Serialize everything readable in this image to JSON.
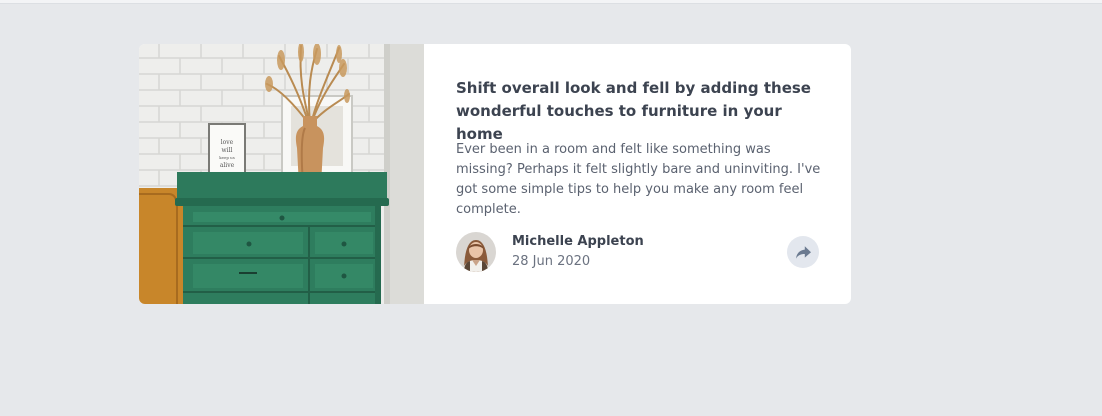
{
  "article": {
    "title": "Shift overall look and fell by adding these wonderful touches to furniture in your home",
    "excerpt": "Ever been in a room and felt like something was missing? Perhaps it felt slightly bare and uninviting. I've got some simple tips to help you make any room feel complete.",
    "image_icon": "drawers-photo",
    "image_text": "love will keep us alive"
  },
  "author": {
    "name": "Michelle Appleton",
    "date": "28 Jun 2020",
    "avatar_icon": "avatar-photo"
  },
  "actions": {
    "share_icon": "share-icon"
  },
  "colors": {
    "page_background": "#e6e8eb",
    "card_background": "#ffffff",
    "title": "#3c4350",
    "body_text": "#5b6270",
    "share_button_background": "#e3e7ee",
    "share_icon": "#6b7a90",
    "dresser_green": "#2e7d5e"
  }
}
